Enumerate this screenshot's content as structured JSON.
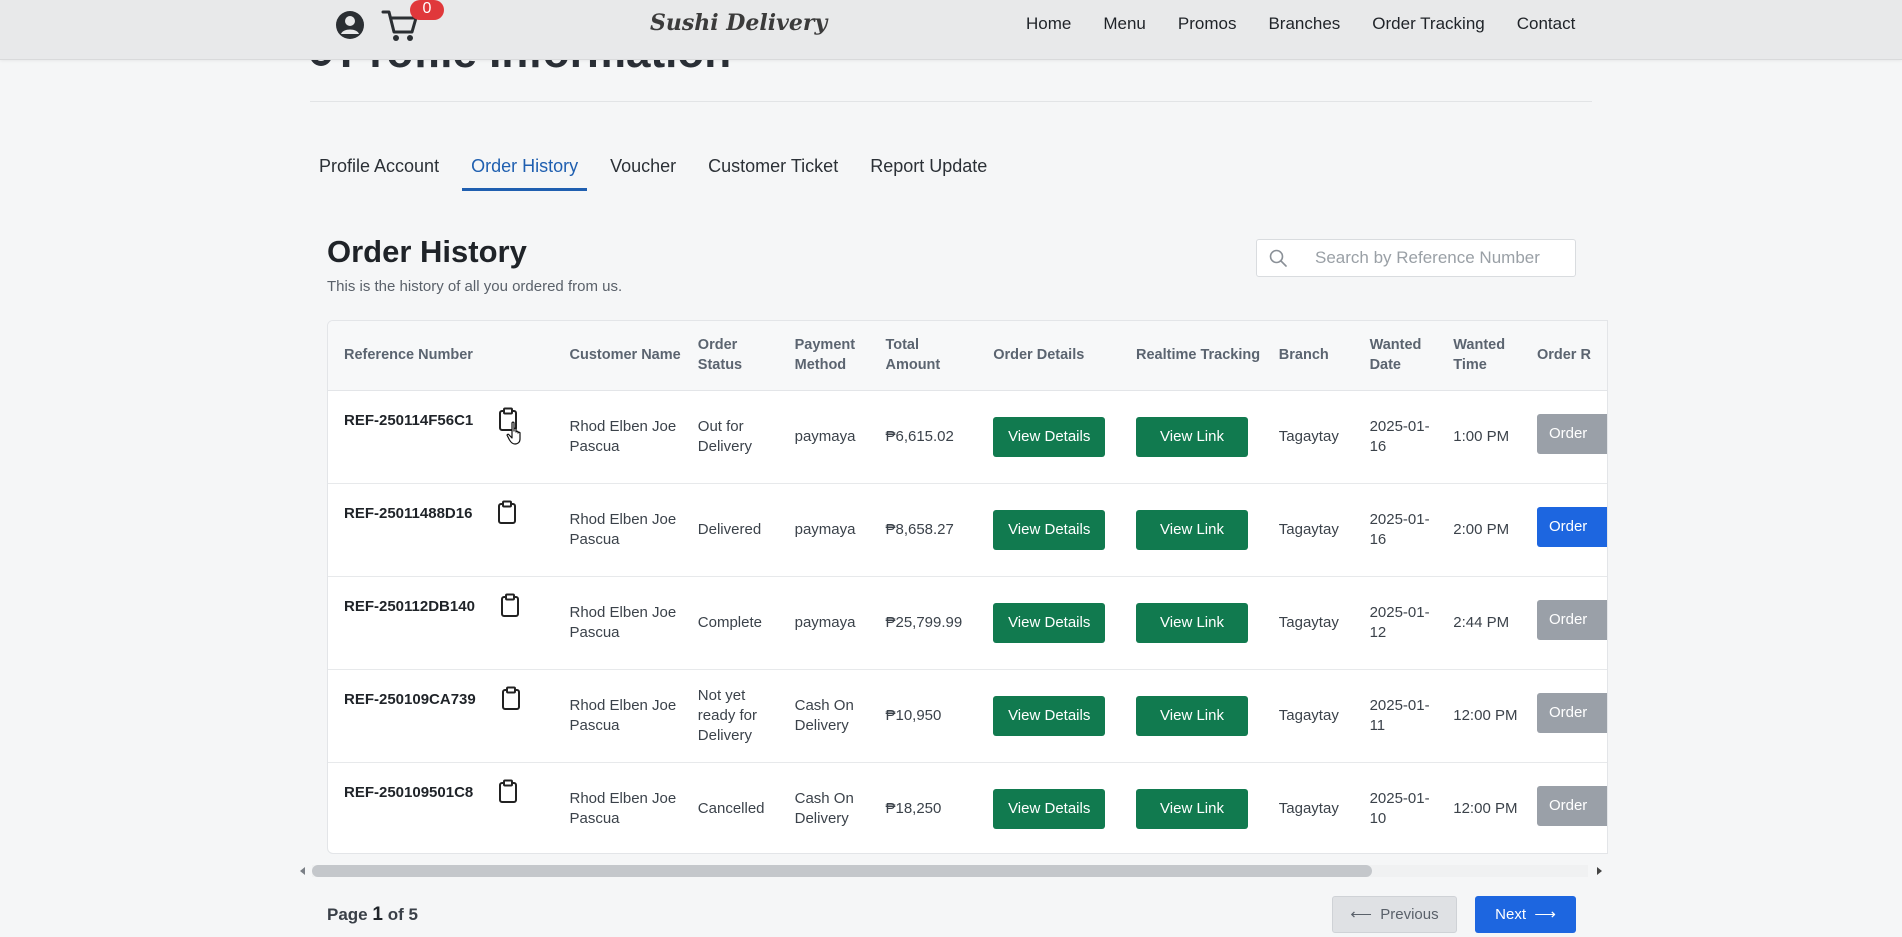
{
  "page": {
    "behind_title": "Profile Information"
  },
  "navbar": {
    "cart_count": "0",
    "logo_text": "Sushi Delivery",
    "links": [
      "Home",
      "Menu",
      "Promos",
      "Branches",
      "Order Tracking",
      "Contact"
    ]
  },
  "tabs": [
    {
      "label": "Profile Account",
      "active": false
    },
    {
      "label": "Order History",
      "active": true
    },
    {
      "label": "Voucher",
      "active": false
    },
    {
      "label": "Customer Ticket",
      "active": false
    },
    {
      "label": "Report Update",
      "active": false
    }
  ],
  "section": {
    "title": "Order History",
    "subtitle": "This is the history of all you ordered from us."
  },
  "search": {
    "placeholder": "Search by Reference Number",
    "value": ""
  },
  "table": {
    "headers": [
      "Reference Number",
      "Customer Name",
      "Order Status",
      "Payment Method",
      "Total Amount",
      "Order Details",
      "Realtime Tracking",
      "Branch",
      "Wanted Date",
      "Wanted Time",
      "Order R"
    ],
    "rows": [
      {
        "ref": "REF-250114F56C1",
        "customer": "Rhod Elben Joe Pascua",
        "status": "Out for Delivery",
        "payment": "paymaya",
        "total": "₱6,615.02",
        "details": "View Details",
        "tracking": "View Link",
        "branch": "Tagaytay",
        "date": "2025-01-16",
        "time": "1:00 PM",
        "order_btn": "Order",
        "order_btn_style": "gray"
      },
      {
        "ref": "REF-25011488D16",
        "customer": "Rhod Elben Joe Pascua",
        "status": "Delivered",
        "payment": "paymaya",
        "total": "₱8,658.27",
        "details": "View Details",
        "tracking": "View Link",
        "branch": "Tagaytay",
        "date": "2025-01-16",
        "time": "2:00 PM",
        "order_btn": "Order",
        "order_btn_style": "blue"
      },
      {
        "ref": "REF-250112DB140",
        "customer": "Rhod Elben Joe Pascua",
        "status": "Complete",
        "payment": "paymaya",
        "total": "₱25,799.99",
        "details": "View Details",
        "tracking": "View Link",
        "branch": "Tagaytay",
        "date": "2025-01-12",
        "time": "2:44 PM",
        "order_btn": "Order",
        "order_btn_style": "gray"
      },
      {
        "ref": "REF-250109CA739",
        "customer": "Rhod Elben Joe Pascua",
        "status": "Not yet ready for Delivery",
        "payment": "Cash On Delivery",
        "total": "₱10,950",
        "details": "View Details",
        "tracking": "View Link",
        "branch": "Tagaytay",
        "date": "2025-01-11",
        "time": "12:00 PM",
        "order_btn": "Order",
        "order_btn_style": "gray"
      },
      {
        "ref": "REF-250109501C8",
        "customer": "Rhod Elben Joe Pascua",
        "status": "Cancelled",
        "payment": "Cash On Delivery",
        "total": "₱18,250",
        "details": "View Details",
        "tracking": "View Link",
        "branch": "Tagaytay",
        "date": "2025-01-10",
        "time": "12:00 PM",
        "order_btn": "Order",
        "order_btn_style": "gray"
      }
    ]
  },
  "pagination": {
    "prefix": "Page",
    "current": "1",
    "of_label": "of 5",
    "prev_label": "Previous",
    "next_label": "Next"
  },
  "colors": {
    "accent_green": "#117a4f",
    "accent_blue": "#1d66e0",
    "badge_red": "#e0383b",
    "tab_active": "#1f5fb0"
  },
  "icons": {
    "user": "user-circle-icon",
    "cart": "shopping-cart-icon",
    "search": "search-icon",
    "copy": "clipboard-icon",
    "prev": "arrow-left-icon",
    "next": "arrow-right-icon"
  }
}
